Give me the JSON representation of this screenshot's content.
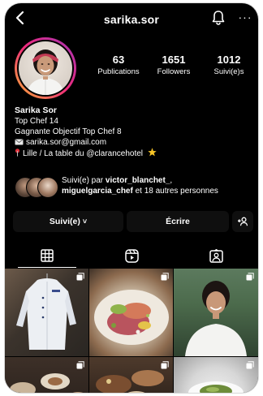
{
  "header": {
    "username": "sarika.sor",
    "back_icon": "chevron-left-icon",
    "bell_icon": "bell-icon",
    "more_icon": "more-icon",
    "more_glyph": "···"
  },
  "profile": {
    "stats": [
      {
        "value": "63",
        "label": "Publications"
      },
      {
        "value": "1651",
        "label": "Followers"
      },
      {
        "value": "1012",
        "label": "Suivi(e)s"
      }
    ],
    "name": "Sarika Sor",
    "bio_lines": {
      "line1": "Top Chef 14",
      "line2": "Gagnante Objectif Top Chef 8",
      "email": "sarika.sor@gmail.com",
      "location": "Lille / La table du @clarancehotel"
    },
    "followed_by": {
      "prefix": "Suivi(e) par ",
      "user1": "victor_blanchet_",
      "separator": ",",
      "user2": "miguelgarcia_chef",
      "suffix": " et 18 autres personnes"
    }
  },
  "actions": {
    "follow_label": "Suivi(e)",
    "follow_chevron": "˅",
    "write_label": "Écrire",
    "add_user_icon": "add-user-icon"
  },
  "tabs": [
    {
      "name": "grid",
      "icon": "grid-icon",
      "active": true
    },
    {
      "name": "reels",
      "icon": "reels-icon",
      "active": false
    },
    {
      "name": "tagged",
      "icon": "tagged-icon",
      "active": false
    }
  ],
  "colors": {
    "background": "#000000",
    "text": "#ffffff",
    "button_bg": "#0f0f0f",
    "story_ring_start": "#f9b233",
    "story_ring_mid": "#ee2a7b",
    "story_ring_end": "#a234b5"
  }
}
